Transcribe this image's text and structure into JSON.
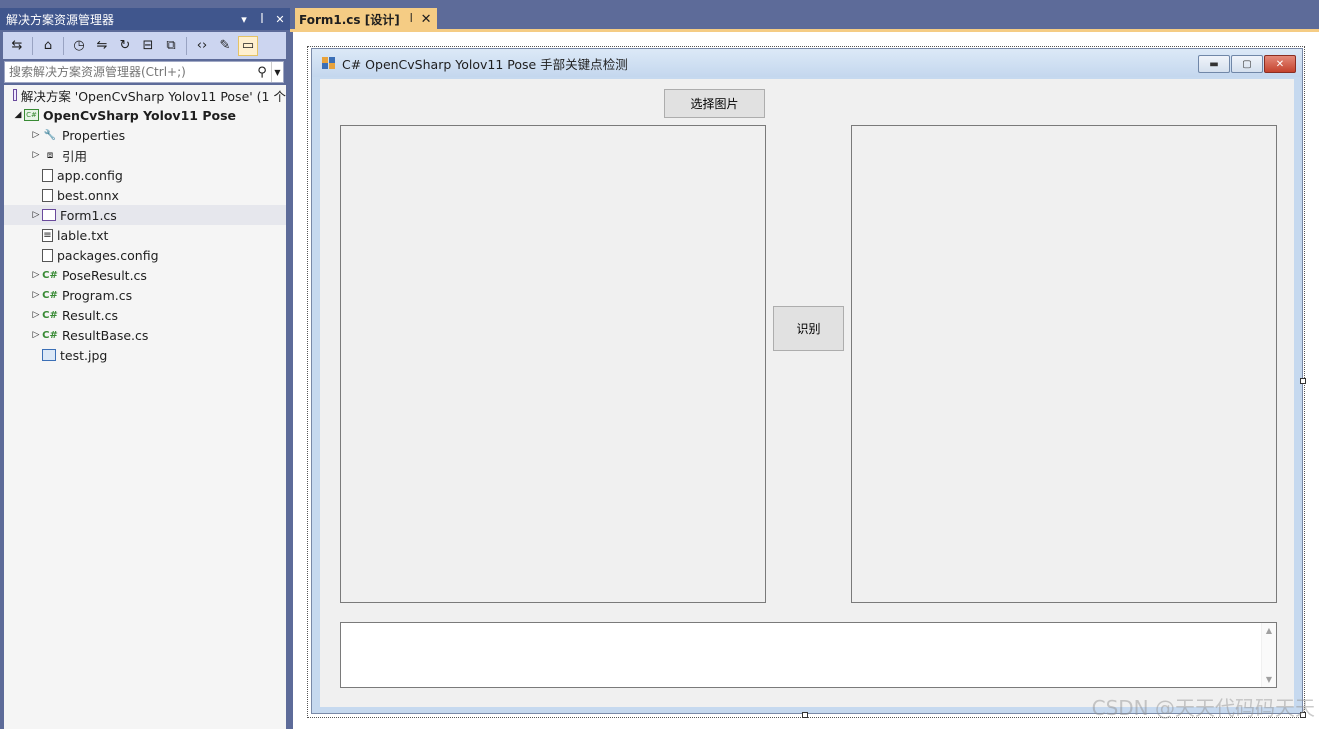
{
  "solution_explorer": {
    "title": "解决方案资源管理器",
    "controls": {
      "dropdown": "▾",
      "pin": "ꟾ",
      "close": "✕"
    },
    "search_placeholder": "搜索解决方案资源管理器(Ctrl+;)",
    "toolbar_icons": [
      "sync-with-active-document-icon",
      "home-icon",
      "pending-changes-filter-icon",
      "switch-views-icon",
      "refresh-icon",
      "collapse-all-icon",
      "show-all-files-icon",
      "view-code-icon",
      "properties-icon",
      "preview-selected-items-icon"
    ],
    "tree": [
      {
        "label": "解决方案 'OpenCvSharp Yolov11 Pose' (1 个",
        "icon": "solution-icon",
        "expander": "",
        "indent": 0
      },
      {
        "label": "OpenCvSharp Yolov11 Pose",
        "icon": "csharp-project-icon",
        "expander": "◢",
        "indent": 0,
        "bold": true
      },
      {
        "label": "Properties",
        "icon": "wrench-icon",
        "expander": "▷",
        "indent": 1
      },
      {
        "label": "引用",
        "icon": "references-icon",
        "expander": "▷",
        "indent": 1
      },
      {
        "label": "app.config",
        "icon": "config-file-icon",
        "expander": "",
        "indent": 1
      },
      {
        "label": "best.onnx",
        "icon": "file-icon",
        "expander": "",
        "indent": 1
      },
      {
        "label": "Form1.cs",
        "icon": "form-icon",
        "expander": "▷",
        "indent": 1,
        "selected": true
      },
      {
        "label": "lable.txt",
        "icon": "text-file-icon",
        "expander": "",
        "indent": 1
      },
      {
        "label": "packages.config",
        "icon": "config-file-icon",
        "expander": "",
        "indent": 1
      },
      {
        "label": "PoseResult.cs",
        "icon": "csharp-file-icon",
        "expander": "▷",
        "indent": 1
      },
      {
        "label": "Program.cs",
        "icon": "csharp-file-icon",
        "expander": "▷",
        "indent": 1
      },
      {
        "label": "Result.cs",
        "icon": "csharp-file-icon",
        "expander": "▷",
        "indent": 1
      },
      {
        "label": "ResultBase.cs",
        "icon": "csharp-file-icon",
        "expander": "▷",
        "indent": 1
      },
      {
        "label": "test.jpg",
        "icon": "image-file-icon",
        "expander": "",
        "indent": 1
      }
    ]
  },
  "editor": {
    "tab": {
      "label": "Form1.cs [设计]",
      "pin": "ꟾ",
      "close": "✕"
    }
  },
  "form": {
    "caption": "C# OpenCvSharp Yolov11 Pose 手部关键点检测",
    "window_buttons": {
      "minimize": "▬",
      "maximize": "▢",
      "close": "✕"
    },
    "select_image_button": "选择图片",
    "detect_button": "识别",
    "output_text": ""
  },
  "watermark": "CSDN @天天代码码天天",
  "colors": {
    "vs_frame": "#5d6b99",
    "vs_title": "#40568d",
    "tab_active": "#f5cc84",
    "form_client": "#f0f0f0",
    "csharp_green": "#388a34"
  }
}
